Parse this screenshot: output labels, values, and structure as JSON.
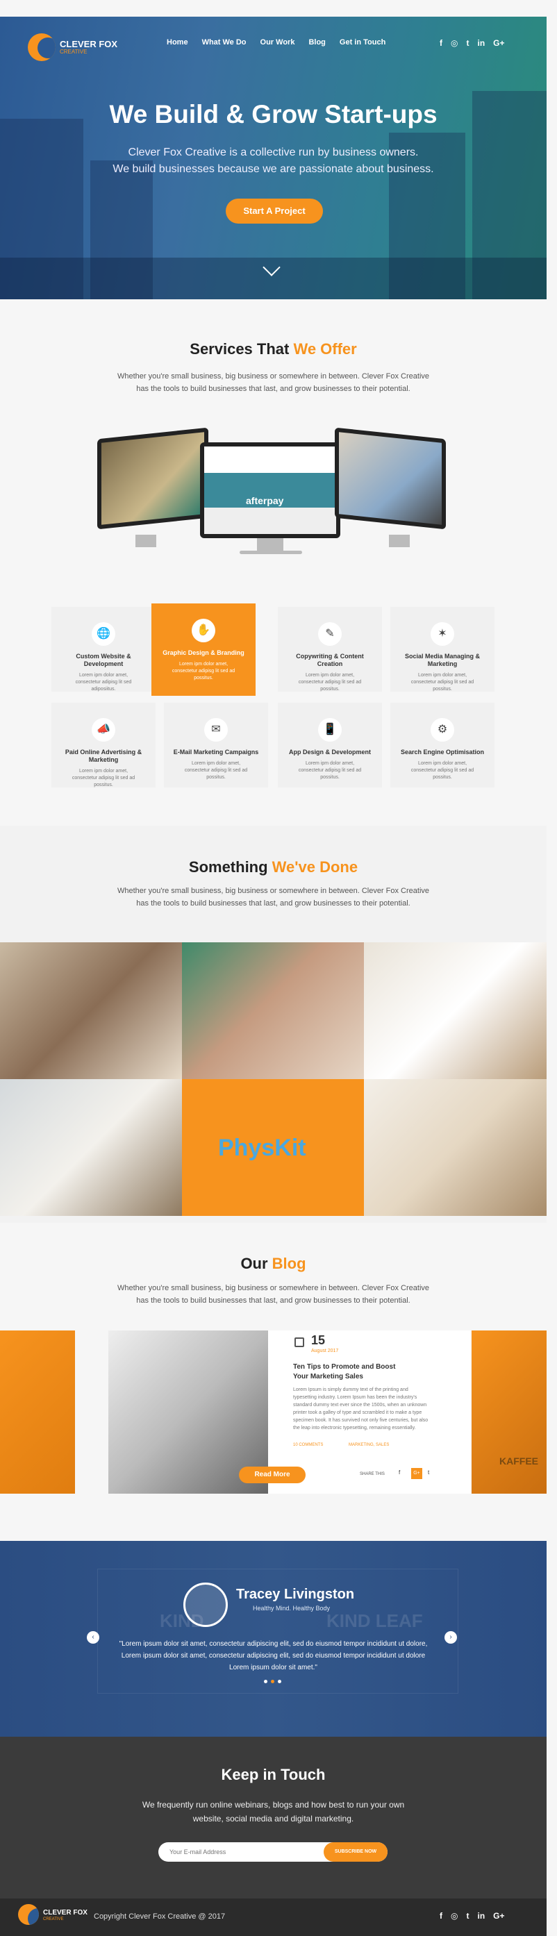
{
  "brand": {
    "name": "CLEVER FOX",
    "tag": "CREATIVE"
  },
  "nav": [
    "Home",
    "What We Do",
    "Our Work",
    "Blog",
    "Get in Touch"
  ],
  "social": [
    "f",
    "◎",
    "t",
    "in",
    "G+"
  ],
  "hero": {
    "title": "We Build & Grow Start-ups",
    "sub1": "Clever Fox Creative is a collective run by business owners.",
    "sub2": "We build businesses because we are passionate about business.",
    "cta": "Start A Project"
  },
  "services": {
    "title_a": "Services That ",
    "title_b": "We Offer",
    "desc1": "Whether you're small business, big business or somewhere in between. Clever Fox Creative",
    "desc2": "has the tools to build businesses that last, and grow businesses to their potential.",
    "screen_text": "afterpay",
    "items": [
      {
        "icon": "🌐",
        "title": "Custom Website & Development",
        "desc": "Lorem ipm dolor amet, consectetur adipisg lit sed adiposiitus."
      },
      {
        "icon": "✋",
        "title": "Graphic Design & Branding",
        "desc": "Lorem ipm dolor amet, consectetur adipisg lit sed ad possitus."
      },
      {
        "icon": "✎",
        "title": "Copywriting & Content Creation",
        "desc": "Lorem ipm dolor amet, consectetur adipisg lit sed ad possitus."
      },
      {
        "icon": "✶",
        "title": "Social Media Managing & Marketing",
        "desc": "Lorem ipm dolor amet, consectetur adipisg lit sed ad possitus."
      },
      {
        "icon": "📣",
        "title": "Paid Online Advertising & Marketing",
        "desc": "Lorem ipm dolor amet, consectetur adipisg lit sed ad possitus."
      },
      {
        "icon": "✉",
        "title": "E-Mail Marketing Campaigns",
        "desc": "Lorem ipm dolor amet, consectetur adipisg lit sed ad possitus."
      },
      {
        "icon": "📱",
        "title": "App Design & Development",
        "desc": "Lorem ipm dolor amet, consectetur adipisg lit sed ad possitus."
      },
      {
        "icon": "⚙",
        "title": "Search Engine Optimisation",
        "desc": "Lorem ipm dolor amet, consectetur adipisg lit sed ad possitus."
      }
    ]
  },
  "work": {
    "title_a": "Something ",
    "title_b": "We've Done",
    "desc1": "Whether you're small business, big business or somewhere in between. Clever Fox Creative",
    "desc2": "has the tools to build businesses that last, and grow businesses to their potential.",
    "physkit": "PhysKit"
  },
  "blog": {
    "title_a": "Our ",
    "title_b": "Blog",
    "desc1": "Whether you're small business, big business or somewhere in between. Clever Fox Creative",
    "desc2": "has the tools to build businesses that last, and grow businesses to their potential.",
    "day": "15",
    "month": "August 2017",
    "post_title": "Ten Tips to Promote and Boost Your Marketing Sales",
    "post_body": "Lorem Ipsum is simply dummy text of the printing and typesetting industry. Lorem Ipsum has been the industry's standard dummy text ever since the 1500s, when an unknown printer took a galley of type and scrambled it to make a type specimen book. It has survived not only five centuries, but also the leap into electronic typesetting, remaining essentially.",
    "comments": "10 COMMENTS",
    "tag": "MARKETING, SALES",
    "read_more": "Read More",
    "share": "SHARE THIS",
    "side_text": "KAFFEE"
  },
  "testimonial": {
    "name": "Tracey Livingston",
    "tag": "Healthy Mind. Healthy Body",
    "quote1": "\"Lorem ipsum dolor sit amet, consectetur adipiscing elit, sed do eiusmod tempor incididunt ut dolore,",
    "quote2": "Lorem ipsum dolor sit amet, consectetur adipiscing elit, sed do eiusmod tempor incididunt ut dolore",
    "quote3": "Lorem ipsum dolor sit amet.\"",
    "bg_a": "KIND",
    "bg_b": "KIND LEAF"
  },
  "contact": {
    "title": "Keep in Touch",
    "desc1": "We frequently run online webinars, blogs and how best to run your own",
    "desc2": "website, social media and digital marketing.",
    "placeholder": "Your E-mail Address",
    "btn": "SUBSCRIBE NOW"
  },
  "footer": {
    "copyright": "Copyright Clever Fox Creative @ 2017"
  },
  "colors": {
    "accent": "#f7931e",
    "hero": "#2c5a94",
    "dark": "#3b3b3b"
  }
}
